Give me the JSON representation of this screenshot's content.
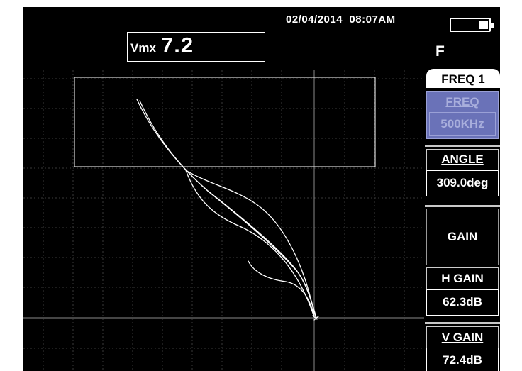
{
  "status": {
    "date": "02/04/2014",
    "time": "08:07AM",
    "battery_icon": "battery-icon",
    "battery_level": 0.3,
    "mode_letter": "F"
  },
  "readout": {
    "label": "Vmx",
    "value": "7.2"
  },
  "panel": {
    "tab": "FREQ 1",
    "freq": {
      "label": "FREQ",
      "value": "500KHz",
      "enabled": false
    },
    "angle": {
      "label": "ANGLE",
      "value": "309.0deg"
    },
    "gain": {
      "label": "GAIN"
    },
    "hgain": {
      "label": "H GAIN",
      "value": "62.3dB"
    },
    "vgain": {
      "label": "V GAIN",
      "value": "72.4dB"
    }
  },
  "colors": {
    "background": "#000000",
    "trace": "#ffffff",
    "grid": "#3a3a3a",
    "disabled_button": "#6a72b8"
  }
}
